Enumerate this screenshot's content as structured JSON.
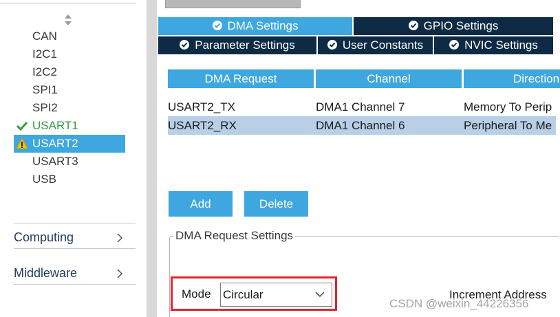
{
  "sidebar": {
    "peripherals": [
      {
        "label": "CAN",
        "status": "none"
      },
      {
        "label": "I2C1",
        "status": "none"
      },
      {
        "label": "I2C2",
        "status": "none"
      },
      {
        "label": "SPI1",
        "status": "none"
      },
      {
        "label": "SPI2",
        "status": "none"
      },
      {
        "label": "USART1",
        "status": "ok"
      },
      {
        "label": "USART2",
        "status": "warning"
      },
      {
        "label": "USART3",
        "status": "none"
      },
      {
        "label": "USB",
        "status": "none"
      }
    ],
    "categories": [
      {
        "label": "Computing"
      },
      {
        "label": "Middleware"
      }
    ]
  },
  "tabs": {
    "row1": [
      {
        "label": "DMA Settings",
        "active": true
      },
      {
        "label": "GPIO Settings",
        "active": false
      }
    ],
    "row2": [
      {
        "label": "Parameter Settings"
      },
      {
        "label": "User Constants"
      },
      {
        "label": "NVIC Settings"
      }
    ]
  },
  "dma_table": {
    "columns": [
      "DMA Request",
      "Channel",
      "Direction"
    ],
    "rows": [
      {
        "request": "USART2_TX",
        "channel": "DMA1 Channel 7",
        "direction": "Memory To Perip",
        "selected": false
      },
      {
        "request": "USART2_RX",
        "channel": "DMA1 Channel 6",
        "direction": "Peripheral To Me",
        "selected": true
      }
    ]
  },
  "actions": {
    "add_label": "Add",
    "delete_label": "Delete"
  },
  "request_settings": {
    "title": "DMA Request Settings",
    "mode_label": "Mode",
    "mode_value": "Circular",
    "increment_label": "Increment Address"
  },
  "watermark": "CSDN @weixin_44226356",
  "colors": {
    "accent": "#3ea7df",
    "tab_dark": "#0e2a45",
    "ok_green": "#2e9e43",
    "warning_yellow": "#f2c300",
    "highlight_red": "#e0242b",
    "selected_row": "#b8cfe6"
  }
}
